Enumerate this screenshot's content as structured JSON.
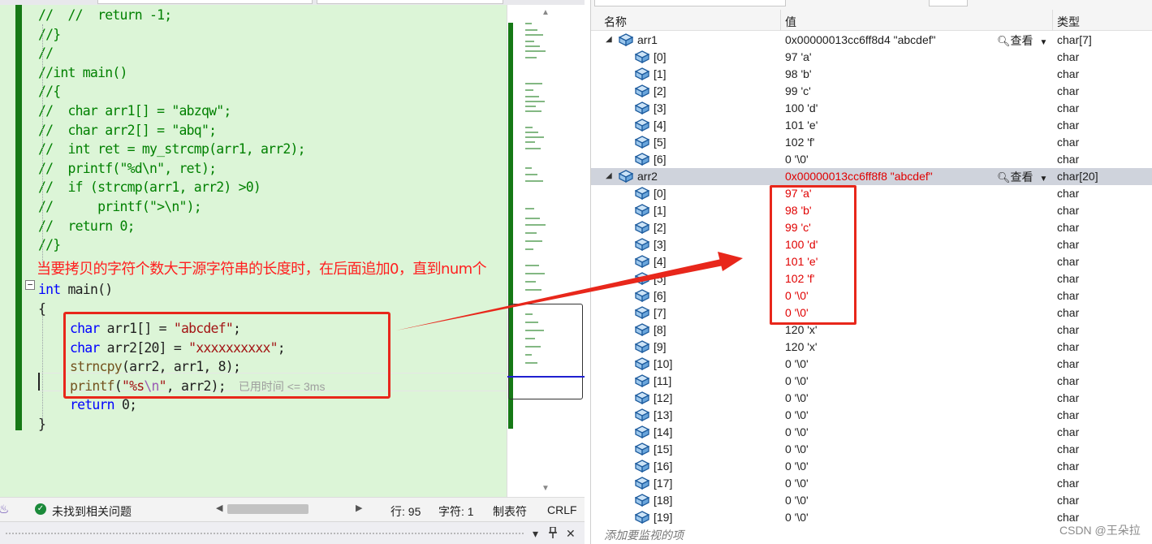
{
  "editor": {
    "code_lines": [
      "//  //  return -1;",
      "//}",
      "//",
      "//int main()",
      "//{",
      "//  char arr1[] = \"abzqw\";",
      "//  char arr2[] = \"abq\";",
      "//  int ret = my_strcmp(arr1, arr2);",
      "//  printf(\"%d\\n\", ret);",
      "//  if (strcmp(arr1, arr2) >0)",
      "//      printf(\">\\n\");",
      "//  return 0;",
      "//}"
    ],
    "fold_symbol": "−",
    "code": {
      "kw_int": "int",
      "main_sig": " main()",
      "brace_open": "{",
      "brace_close": "}",
      "kw_char": "char",
      "arr1_decl": " arr1[] = ",
      "arr1_str": "\"abcdef\"",
      "semicolon": ";",
      "arr2_decl": " arr2[20] = ",
      "arr2_str": "\"xxxxxxxxxx\"",
      "strncpy_fn": "strncpy",
      "strncpy_args": "(arr2, arr1, 8);",
      "printf_fn": "printf",
      "printf_open": "(",
      "printf_str_a": "\"%s",
      "printf_esc": "\\n",
      "printf_str_b": "\"",
      "printf_rest": ", arr2);",
      "elapsed_hint": "已用时间 <= 3ms",
      "kw_return": "return",
      "return_rest": " 0;"
    },
    "annotation": "当要拷贝的字符个数大于源字符串的长度时，在后面追加0，直到num个"
  },
  "status_bar": {
    "issues": "未找到相关问题",
    "line": "行: 95",
    "char": "字符: 1",
    "tabs": "制表符",
    "eol": "CRLF",
    "pin_icon": "pin-icon",
    "close_icon": "✕",
    "dropdown_icon": "▾"
  },
  "watch": {
    "headers": {
      "name": "名称",
      "value": "值",
      "type": "类型"
    },
    "view_label": "查看",
    "rows": [
      {
        "name": "arr1",
        "value": "0x00000013cc6ff8d4 \"abcdef\"",
        "type": "char[7]",
        "level": 0,
        "expanded": true,
        "view": true,
        "red": false,
        "selected": false
      },
      {
        "name": "[0]",
        "value": "97 'a'",
        "type": "char",
        "level": 1,
        "red": false
      },
      {
        "name": "[1]",
        "value": "98 'b'",
        "type": "char",
        "level": 1,
        "red": false
      },
      {
        "name": "[2]",
        "value": "99 'c'",
        "type": "char",
        "level": 1,
        "red": false
      },
      {
        "name": "[3]",
        "value": "100 'd'",
        "type": "char",
        "level": 1,
        "red": false
      },
      {
        "name": "[4]",
        "value": "101 'e'",
        "type": "char",
        "level": 1,
        "red": false
      },
      {
        "name": "[5]",
        "value": "102 'f'",
        "type": "char",
        "level": 1,
        "red": false
      },
      {
        "name": "[6]",
        "value": "0 '\\0'",
        "type": "char",
        "level": 1,
        "red": false
      },
      {
        "name": "arr2",
        "value": "0x00000013cc6ff8f8 \"abcdef\"",
        "type": "char[20]",
        "level": 0,
        "expanded": true,
        "view": true,
        "red": true,
        "selected": true
      },
      {
        "name": "[0]",
        "value": "97 'a'",
        "type": "char",
        "level": 1,
        "red": true
      },
      {
        "name": "[1]",
        "value": "98 'b'",
        "type": "char",
        "level": 1,
        "red": true
      },
      {
        "name": "[2]",
        "value": "99 'c'",
        "type": "char",
        "level": 1,
        "red": true
      },
      {
        "name": "[3]",
        "value": "100 'd'",
        "type": "char",
        "level": 1,
        "red": true
      },
      {
        "name": "[4]",
        "value": "101 'e'",
        "type": "char",
        "level": 1,
        "red": true
      },
      {
        "name": "[5]",
        "value": "102 'f'",
        "type": "char",
        "level": 1,
        "red": true
      },
      {
        "name": "[6]",
        "value": "0 '\\0'",
        "type": "char",
        "level": 1,
        "red": true
      },
      {
        "name": "[7]",
        "value": "0 '\\0'",
        "type": "char",
        "level": 1,
        "red": true
      },
      {
        "name": "[8]",
        "value": "120 'x'",
        "type": "char",
        "level": 1,
        "red": false
      },
      {
        "name": "[9]",
        "value": "120 'x'",
        "type": "char",
        "level": 1,
        "red": false
      },
      {
        "name": "[10]",
        "value": "0 '\\0'",
        "type": "char",
        "level": 1,
        "red": false
      },
      {
        "name": "[11]",
        "value": "0 '\\0'",
        "type": "char",
        "level": 1,
        "red": false
      },
      {
        "name": "[12]",
        "value": "0 '\\0'",
        "type": "char",
        "level": 1,
        "red": false
      },
      {
        "name": "[13]",
        "value": "0 '\\0'",
        "type": "char",
        "level": 1,
        "red": false
      },
      {
        "name": "[14]",
        "value": "0 '\\0'",
        "type": "char",
        "level": 1,
        "red": false
      },
      {
        "name": "[15]",
        "value": "0 '\\0'",
        "type": "char",
        "level": 1,
        "red": false
      },
      {
        "name": "[16]",
        "value": "0 '\\0'",
        "type": "char",
        "level": 1,
        "red": false
      },
      {
        "name": "[17]",
        "value": "0 '\\0'",
        "type": "char",
        "level": 1,
        "red": false
      },
      {
        "name": "[18]",
        "value": "0 '\\0'",
        "type": "char",
        "level": 1,
        "red": false
      },
      {
        "name": "[19]",
        "value": "0 '\\0'",
        "type": "char",
        "level": 1,
        "red": false
      }
    ],
    "add_watch_placeholder": "添加要监视的项"
  },
  "watermark": "CSDN @王朵拉",
  "colors": {
    "code_bg": "#dcf5d7",
    "comment": "#008000",
    "keyword": "#0000ff",
    "string": "#a31515",
    "annotation_red": "#e8271b",
    "changed_value_red": "#e00000"
  }
}
